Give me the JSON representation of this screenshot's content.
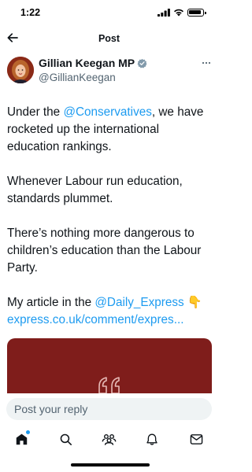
{
  "status_bar": {
    "time": "1:22",
    "icons": [
      "signal-icon",
      "wifi-icon",
      "battery-icon"
    ]
  },
  "nav": {
    "back_icon": "arrow-left-icon",
    "title": "Post"
  },
  "author": {
    "name": "Gillian Keegan MP",
    "verified_icon": "verified-badge-icon",
    "handle": "@GillianKeegan",
    "more_icon": "more-horizontal-icon"
  },
  "tweet": {
    "p1_before": "Under the ",
    "p1_mention": "@Conservatives",
    "p1_after": ", we have rocketed up the international education rankings.",
    "p2": "Whenever Labour run education, standards plummet.",
    "p3": "There’s nothing more dangerous to children’s education than the Labour Party.",
    "p4_before": "My article in the ",
    "p4_mention": "@Daily_Express",
    "p4_emoji": " 👇",
    "p4_link": "express.co.uk/comment/expres..."
  },
  "media": {
    "background": "#7f1d1b",
    "icon": "quote-mark-icon"
  },
  "reply": {
    "placeholder": "Post your reply"
  },
  "tab_bar": {
    "tabs": [
      "home-icon",
      "search-icon",
      "communities-icon",
      "notifications-icon",
      "messages-icon"
    ],
    "accent": "#1d9bf0"
  },
  "colors": {
    "text": "#0f1419",
    "secondary": "#536471",
    "link": "#1d9bf0",
    "verified": "#829aab"
  }
}
